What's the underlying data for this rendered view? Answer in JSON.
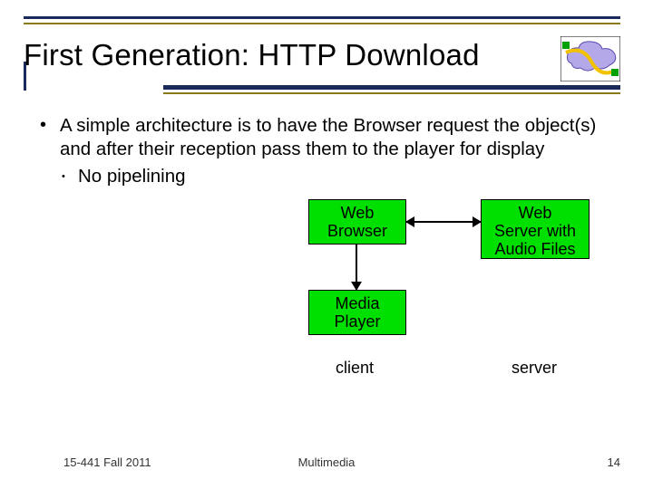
{
  "title": "First Generation: HTTP Download",
  "bullets": {
    "main": "A simple architecture is to have the Browser request the object(s) and after their reception pass them to the player for display",
    "sub": "No pipelining"
  },
  "diagram": {
    "web_browser": "Web\nBrowser",
    "media_player": "Media\nPlayer",
    "web_server": "Web\nServer with\nAudio Files",
    "client_label": "client",
    "server_label": "server"
  },
  "footer": {
    "left": "15-441 Fall 2011",
    "center": "Multimedia",
    "right": "14"
  }
}
